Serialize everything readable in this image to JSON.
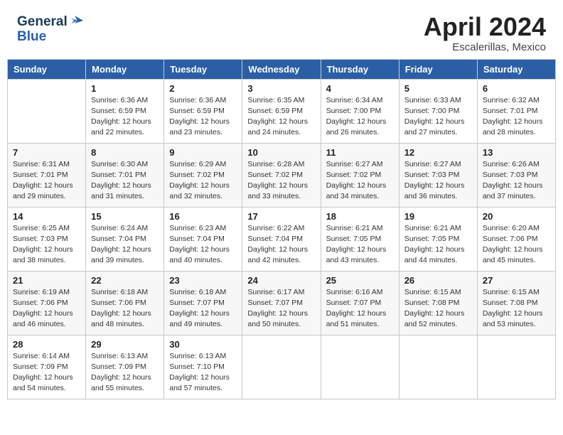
{
  "header": {
    "logo_line1": "General",
    "logo_line2": "Blue",
    "month": "April 2024",
    "location": "Escalerillas, Mexico"
  },
  "days_of_week": [
    "Sunday",
    "Monday",
    "Tuesday",
    "Wednesday",
    "Thursday",
    "Friday",
    "Saturday"
  ],
  "weeks": [
    [
      {
        "day": "",
        "sunrise": "",
        "sunset": "",
        "daylight": ""
      },
      {
        "day": "1",
        "sunrise": "Sunrise: 6:36 AM",
        "sunset": "Sunset: 6:59 PM",
        "daylight": "Daylight: 12 hours and 22 minutes."
      },
      {
        "day": "2",
        "sunrise": "Sunrise: 6:36 AM",
        "sunset": "Sunset: 6:59 PM",
        "daylight": "Daylight: 12 hours and 23 minutes."
      },
      {
        "day": "3",
        "sunrise": "Sunrise: 6:35 AM",
        "sunset": "Sunset: 6:59 PM",
        "daylight": "Daylight: 12 hours and 24 minutes."
      },
      {
        "day": "4",
        "sunrise": "Sunrise: 6:34 AM",
        "sunset": "Sunset: 7:00 PM",
        "daylight": "Daylight: 12 hours and 26 minutes."
      },
      {
        "day": "5",
        "sunrise": "Sunrise: 6:33 AM",
        "sunset": "Sunset: 7:00 PM",
        "daylight": "Daylight: 12 hours and 27 minutes."
      },
      {
        "day": "6",
        "sunrise": "Sunrise: 6:32 AM",
        "sunset": "Sunset: 7:01 PM",
        "daylight": "Daylight: 12 hours and 28 minutes."
      }
    ],
    [
      {
        "day": "7",
        "sunrise": "Sunrise: 6:31 AM",
        "sunset": "Sunset: 7:01 PM",
        "daylight": "Daylight: 12 hours and 29 minutes."
      },
      {
        "day": "8",
        "sunrise": "Sunrise: 6:30 AM",
        "sunset": "Sunset: 7:01 PM",
        "daylight": "Daylight: 12 hours and 31 minutes."
      },
      {
        "day": "9",
        "sunrise": "Sunrise: 6:29 AM",
        "sunset": "Sunset: 7:02 PM",
        "daylight": "Daylight: 12 hours and 32 minutes."
      },
      {
        "day": "10",
        "sunrise": "Sunrise: 6:28 AM",
        "sunset": "Sunset: 7:02 PM",
        "daylight": "Daylight: 12 hours and 33 minutes."
      },
      {
        "day": "11",
        "sunrise": "Sunrise: 6:27 AM",
        "sunset": "Sunset: 7:02 PM",
        "daylight": "Daylight: 12 hours and 34 minutes."
      },
      {
        "day": "12",
        "sunrise": "Sunrise: 6:27 AM",
        "sunset": "Sunset: 7:03 PM",
        "daylight": "Daylight: 12 hours and 36 minutes."
      },
      {
        "day": "13",
        "sunrise": "Sunrise: 6:26 AM",
        "sunset": "Sunset: 7:03 PM",
        "daylight": "Daylight: 12 hours and 37 minutes."
      }
    ],
    [
      {
        "day": "14",
        "sunrise": "Sunrise: 6:25 AM",
        "sunset": "Sunset: 7:03 PM",
        "daylight": "Daylight: 12 hours and 38 minutes."
      },
      {
        "day": "15",
        "sunrise": "Sunrise: 6:24 AM",
        "sunset": "Sunset: 7:04 PM",
        "daylight": "Daylight: 12 hours and 39 minutes."
      },
      {
        "day": "16",
        "sunrise": "Sunrise: 6:23 AM",
        "sunset": "Sunset: 7:04 PM",
        "daylight": "Daylight: 12 hours and 40 minutes."
      },
      {
        "day": "17",
        "sunrise": "Sunrise: 6:22 AM",
        "sunset": "Sunset: 7:04 PM",
        "daylight": "Daylight: 12 hours and 42 minutes."
      },
      {
        "day": "18",
        "sunrise": "Sunrise: 6:21 AM",
        "sunset": "Sunset: 7:05 PM",
        "daylight": "Daylight: 12 hours and 43 minutes."
      },
      {
        "day": "19",
        "sunrise": "Sunrise: 6:21 AM",
        "sunset": "Sunset: 7:05 PM",
        "daylight": "Daylight: 12 hours and 44 minutes."
      },
      {
        "day": "20",
        "sunrise": "Sunrise: 6:20 AM",
        "sunset": "Sunset: 7:06 PM",
        "daylight": "Daylight: 12 hours and 45 minutes."
      }
    ],
    [
      {
        "day": "21",
        "sunrise": "Sunrise: 6:19 AM",
        "sunset": "Sunset: 7:06 PM",
        "daylight": "Daylight: 12 hours and 46 minutes."
      },
      {
        "day": "22",
        "sunrise": "Sunrise: 6:18 AM",
        "sunset": "Sunset: 7:06 PM",
        "daylight": "Daylight: 12 hours and 48 minutes."
      },
      {
        "day": "23",
        "sunrise": "Sunrise: 6:18 AM",
        "sunset": "Sunset: 7:07 PM",
        "daylight": "Daylight: 12 hours and 49 minutes."
      },
      {
        "day": "24",
        "sunrise": "Sunrise: 6:17 AM",
        "sunset": "Sunset: 7:07 PM",
        "daylight": "Daylight: 12 hours and 50 minutes."
      },
      {
        "day": "25",
        "sunrise": "Sunrise: 6:16 AM",
        "sunset": "Sunset: 7:07 PM",
        "daylight": "Daylight: 12 hours and 51 minutes."
      },
      {
        "day": "26",
        "sunrise": "Sunrise: 6:15 AM",
        "sunset": "Sunset: 7:08 PM",
        "daylight": "Daylight: 12 hours and 52 minutes."
      },
      {
        "day": "27",
        "sunrise": "Sunrise: 6:15 AM",
        "sunset": "Sunset: 7:08 PM",
        "daylight": "Daylight: 12 hours and 53 minutes."
      }
    ],
    [
      {
        "day": "28",
        "sunrise": "Sunrise: 6:14 AM",
        "sunset": "Sunset: 7:09 PM",
        "daylight": "Daylight: 12 hours and 54 minutes."
      },
      {
        "day": "29",
        "sunrise": "Sunrise: 6:13 AM",
        "sunset": "Sunset: 7:09 PM",
        "daylight": "Daylight: 12 hours and 55 minutes."
      },
      {
        "day": "30",
        "sunrise": "Sunrise: 6:13 AM",
        "sunset": "Sunset: 7:10 PM",
        "daylight": "Daylight: 12 hours and 57 minutes."
      },
      {
        "day": "",
        "sunrise": "",
        "sunset": "",
        "daylight": ""
      },
      {
        "day": "",
        "sunrise": "",
        "sunset": "",
        "daylight": ""
      },
      {
        "day": "",
        "sunrise": "",
        "sunset": "",
        "daylight": ""
      },
      {
        "day": "",
        "sunrise": "",
        "sunset": "",
        "daylight": ""
      }
    ]
  ]
}
